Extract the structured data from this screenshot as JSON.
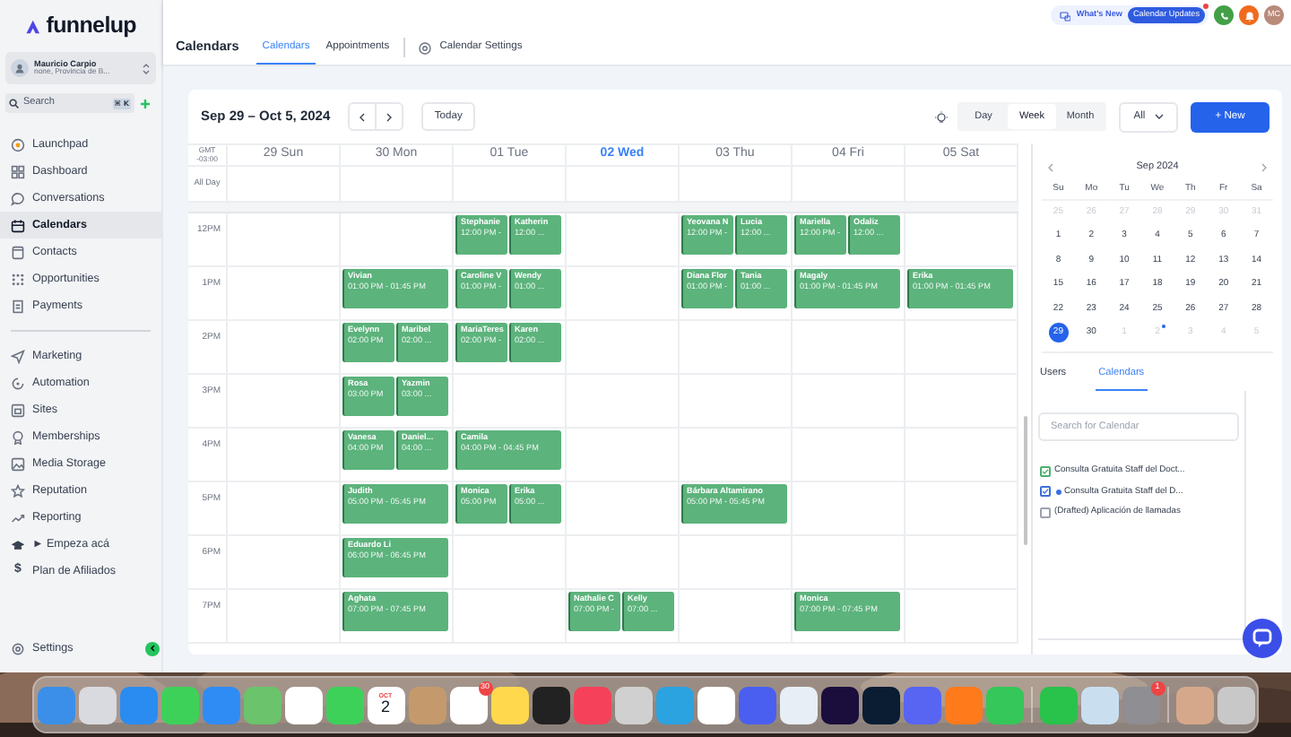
{
  "sidebar": {
    "brand": "funnelup",
    "account": {
      "name": "Mauricio Carpio",
      "subtitle": "none, Provincia de B..."
    },
    "search": {
      "placeholder": "Search",
      "shortcut": "⌘ K"
    },
    "groups": [
      {
        "items": [
          {
            "label": "Launchpad",
            "selected": false
          },
          {
            "label": "Dashboard",
            "selected": false
          },
          {
            "label": "Conversations",
            "selected": false
          },
          {
            "label": "Calendars",
            "selected": true
          },
          {
            "label": "Contacts",
            "selected": false
          },
          {
            "label": "Opportunities",
            "selected": false
          },
          {
            "label": "Payments",
            "selected": false
          }
        ]
      },
      {
        "items": [
          {
            "label": "Marketing",
            "selected": false
          },
          {
            "label": "Automation",
            "selected": false
          },
          {
            "label": "Sites",
            "selected": false
          },
          {
            "label": "Memberships",
            "selected": false
          },
          {
            "label": "Media Storage",
            "selected": false
          },
          {
            "label": "Reputation",
            "selected": false
          },
          {
            "label": "Reporting",
            "selected": false
          },
          {
            "label": "► Empeza acá",
            "selected": false
          },
          {
            "label": "Plan de Afiliados",
            "selected": false,
            "glyph": "$"
          }
        ]
      }
    ],
    "footer_item": {
      "label": "Settings",
      "selected": false
    }
  },
  "header": {
    "whats_new": "What's New",
    "updates_badge": "Calendar Updates",
    "avatar": "MC",
    "title": "Calendars",
    "tabs": [
      {
        "label": "Calendars",
        "selected": true
      },
      {
        "label": "Appointments",
        "selected": false
      }
    ],
    "settings_link": "Calendar Settings"
  },
  "toolbar": {
    "range": "Sep 29 – Oct 5, 2024",
    "today": "Today",
    "views": [
      {
        "label": "Day",
        "selected": false
      },
      {
        "label": "Week",
        "selected": true
      },
      {
        "label": "Month",
        "selected": false
      }
    ],
    "filter": "All",
    "new_button": "+ New"
  },
  "grid": {
    "timezone": [
      "GMT",
      "-03:00"
    ],
    "all_day": "All Day",
    "days": [
      {
        "label": "29 Sun",
        "today": false
      },
      {
        "label": "30 Mon",
        "today": false
      },
      {
        "label": "01 Tue",
        "today": false
      },
      {
        "label": "02 Wed",
        "today": true
      },
      {
        "label": "03 Thu",
        "today": false
      },
      {
        "label": "04 Fri",
        "today": false
      },
      {
        "label": "05 Sat",
        "today": false
      }
    ],
    "rows": [
      {
        "label": "12PM",
        "cells": [
          [],
          [],
          [
            {
              "name": "Stephanie",
              "time": "12:00 PM -"
            },
            {
              "name": "Katherin",
              "time": "12:00 ..."
            }
          ],
          [],
          [
            {
              "name": "Yeovana N",
              "time": "12:00 PM -"
            },
            {
              "name": "Lucia",
              "time": "12:00 ..."
            }
          ],
          [
            {
              "name": "Mariella",
              "time": "12:00 PM -"
            },
            {
              "name": "Odaliz",
              "time": "12:00 ..."
            }
          ],
          []
        ]
      },
      {
        "label": "1PM",
        "cells": [
          [],
          [
            {
              "name": "Vivian",
              "time": "01:00 PM - 01:45 PM"
            }
          ],
          [
            {
              "name": "Caroline V",
              "time": "01:00 PM -"
            },
            {
              "name": "Wendy",
              "time": "01:00 ..."
            }
          ],
          [],
          [
            {
              "name": "Diana Flor",
              "time": "01:00 PM -"
            },
            {
              "name": "Tania",
              "time": "01:00 ..."
            }
          ],
          [
            {
              "name": "Magaly",
              "time": "01:00 PM - 01:45 PM"
            }
          ],
          [
            {
              "name": "Erika",
              "time": "01:00 PM - 01:45 PM"
            }
          ]
        ]
      },
      {
        "label": "2PM",
        "cells": [
          [],
          [
            {
              "name": "Evelynn",
              "time": "02:00 PM"
            },
            {
              "name": "Maribel",
              "time": "02:00 ..."
            }
          ],
          [
            {
              "name": "MariaTeres",
              "time": "02:00 PM -"
            },
            {
              "name": "Karen",
              "time": "02:00 ..."
            }
          ],
          [],
          [],
          [],
          []
        ]
      },
      {
        "label": "3PM",
        "cells": [
          [],
          [
            {
              "name": "Rosa",
              "time": "03:00 PM"
            },
            {
              "name": "Yazmin",
              "time": "03:00 ..."
            }
          ],
          [],
          [],
          [],
          [],
          []
        ]
      },
      {
        "label": "4PM",
        "cells": [
          [],
          [
            {
              "name": "Vanesa",
              "time": "04:00 PM"
            },
            {
              "name": "Daniel...",
              "time": "04:00 ..."
            }
          ],
          [
            {
              "name": "Camila",
              "time": "04:00 PM - 04:45 PM"
            }
          ],
          [],
          [],
          [],
          []
        ]
      },
      {
        "label": "5PM",
        "cells": [
          [],
          [
            {
              "name": "Judith",
              "time": "05:00 PM - 05:45 PM"
            }
          ],
          [
            {
              "name": "Monica",
              "time": "05:00 PM"
            },
            {
              "name": "Erika",
              "time": "05:00 ..."
            }
          ],
          [],
          [
            {
              "name": "Bárbara Altamirano",
              "time": "05:00 PM - 05:45 PM"
            }
          ],
          [],
          []
        ]
      },
      {
        "label": "6PM",
        "cells": [
          [],
          [
            {
              "name": "Eduardo Li",
              "time": "06:00 PM - 06:45 PM"
            }
          ],
          [],
          [],
          [],
          [],
          []
        ]
      },
      {
        "label": "7PM",
        "cells": [
          [],
          [
            {
              "name": "Aghata",
              "time": "07:00 PM - 07:45 PM"
            }
          ],
          [],
          [
            {
              "name": "Nathalie C",
              "time": "07:00 PM -"
            },
            {
              "name": "Kelly",
              "time": "07:00 ..."
            }
          ],
          [],
          [
            {
              "name": "Monica",
              "time": "07:00 PM - 07:45 PM"
            }
          ],
          []
        ]
      }
    ]
  },
  "mini_calendar": {
    "month": "Sep 2024",
    "weekdays": [
      "Su",
      "Mo",
      "Tu",
      "We",
      "Th",
      "Fr",
      "Sa"
    ],
    "weeks": [
      [
        {
          "day": "25",
          "outside": true,
          "selected": false,
          "marked": false
        },
        {
          "day": "26",
          "outside": true,
          "selected": false,
          "marked": false
        },
        {
          "day": "27",
          "outside": true,
          "selected": false,
          "marked": false
        },
        {
          "day": "28",
          "outside": true,
          "selected": false,
          "marked": false
        },
        {
          "day": "29",
          "outside": true,
          "selected": false,
          "marked": false
        },
        {
          "day": "30",
          "outside": true,
          "selected": false,
          "marked": false
        },
        {
          "day": "31",
          "outside": true,
          "selected": false,
          "marked": false
        }
      ],
      [
        {
          "day": "1",
          "outside": false,
          "selected": false,
          "marked": false
        },
        {
          "day": "2",
          "outside": false,
          "selected": false,
          "marked": false
        },
        {
          "day": "3",
          "outside": false,
          "selected": false,
          "marked": false
        },
        {
          "day": "4",
          "outside": false,
          "selected": false,
          "marked": false
        },
        {
          "day": "5",
          "outside": false,
          "selected": false,
          "marked": false
        },
        {
          "day": "6",
          "outside": false,
          "selected": false,
          "marked": false
        },
        {
          "day": "7",
          "outside": false,
          "selected": false,
          "marked": false
        }
      ],
      [
        {
          "day": "8",
          "outside": false,
          "selected": false,
          "marked": false
        },
        {
          "day": "9",
          "outside": false,
          "selected": false,
          "marked": false
        },
        {
          "day": "10",
          "outside": false,
          "selected": false,
          "marked": false
        },
        {
          "day": "11",
          "outside": false,
          "selected": false,
          "marked": false
        },
        {
          "day": "12",
          "outside": false,
          "selected": false,
          "marked": false
        },
        {
          "day": "13",
          "outside": false,
          "selected": false,
          "marked": false
        },
        {
          "day": "14",
          "outside": false,
          "selected": false,
          "marked": false
        }
      ],
      [
        {
          "day": "15",
          "outside": false,
          "selected": false,
          "marked": false
        },
        {
          "day": "16",
          "outside": false,
          "selected": false,
          "marked": false
        },
        {
          "day": "17",
          "outside": false,
          "selected": false,
          "marked": false
        },
        {
          "day": "18",
          "outside": false,
          "selected": false,
          "marked": false
        },
        {
          "day": "19",
          "outside": false,
          "selected": false,
          "marked": false
        },
        {
          "day": "20",
          "outside": false,
          "selected": false,
          "marked": false
        },
        {
          "day": "21",
          "outside": false,
          "selected": false,
          "marked": false
        }
      ],
      [
        {
          "day": "22",
          "outside": false,
          "selected": false,
          "marked": false
        },
        {
          "day": "23",
          "outside": false,
          "selected": false,
          "marked": false
        },
        {
          "day": "24",
          "outside": false,
          "selected": false,
          "marked": false
        },
        {
          "day": "25",
          "outside": false,
          "selected": false,
          "marked": false
        },
        {
          "day": "26",
          "outside": false,
          "selected": false,
          "marked": false
        },
        {
          "day": "27",
          "outside": false,
          "selected": false,
          "marked": false
        },
        {
          "day": "28",
          "outside": false,
          "selected": false,
          "marked": false
        }
      ],
      [
        {
          "day": "29",
          "outside": false,
          "selected": true,
          "marked": false
        },
        {
          "day": "30",
          "outside": false,
          "selected": false,
          "marked": false
        },
        {
          "day": "1",
          "outside": true,
          "selected": false,
          "marked": false
        },
        {
          "day": "2",
          "outside": true,
          "selected": false,
          "marked": true
        },
        {
          "day": "3",
          "outside": true,
          "selected": false,
          "marked": false
        },
        {
          "day": "4",
          "outside": true,
          "selected": false,
          "marked": false
        },
        {
          "day": "5",
          "outside": true,
          "selected": false,
          "marked": false
        }
      ]
    ]
  },
  "panel_tabs": [
    {
      "label": "Users",
      "selected": false
    },
    {
      "label": "Calendars",
      "selected": true
    }
  ],
  "calendar_search": {
    "placeholder": "Search for Calendar"
  },
  "calendar_list": [
    {
      "label": "Consulta Gratuita Staff del Doct...",
      "checked": true,
      "color": "#4caf6e",
      "dot": false
    },
    {
      "label": "Consulta Gratuita Staff del D...",
      "checked": true,
      "color": "#3b6fe0",
      "dot": true
    },
    {
      "label": "(Drafted) Aplicación de llamadas",
      "checked": false,
      "color": "#9ca3af",
      "dot": false
    }
  ],
  "dock": {
    "items": [
      {
        "color": "#3b8fe8"
      },
      {
        "color": "#d9d9e0"
      },
      {
        "color": "#2a8cf0"
      },
      {
        "color": "#3ed15a"
      },
      {
        "color": "#2f8cf5"
      },
      {
        "color": "#6bc36b"
      },
      {
        "color": "#ffffff"
      },
      {
        "color": "#3ed15a"
      },
      {
        "color": "#ffffff",
        "month": "OCT",
        "day": "2"
      },
      {
        "color": "#c49a6c"
      },
      {
        "color": "#ffffff",
        "badge": "30"
      },
      {
        "color": "#ffd84d"
      },
      {
        "color": "#222222"
      },
      {
        "color": "#f5425a"
      },
      {
        "color": "#d0d0d0"
      },
      {
        "color": "#2aa3e0"
      },
      {
        "color": "#ffffff"
      },
      {
        "color": "#4a5ff0"
      },
      {
        "color": "#e8eef5"
      },
      {
        "color": "#1b0e3d"
      },
      {
        "color": "#0a1d33"
      },
      {
        "color": "#5865f2"
      },
      {
        "color": "#ff7a1a"
      },
      {
        "color": "#35c759",
        "separator_after": true
      },
      {
        "color": "#29c24a"
      },
      {
        "color": "#c9dff0"
      },
      {
        "color": "#8e8e93",
        "badge": "1",
        "separator_after": true
      },
      {
        "color": "#d6a88b"
      },
      {
        "color": "#c8c8c8"
      }
    ]
  }
}
